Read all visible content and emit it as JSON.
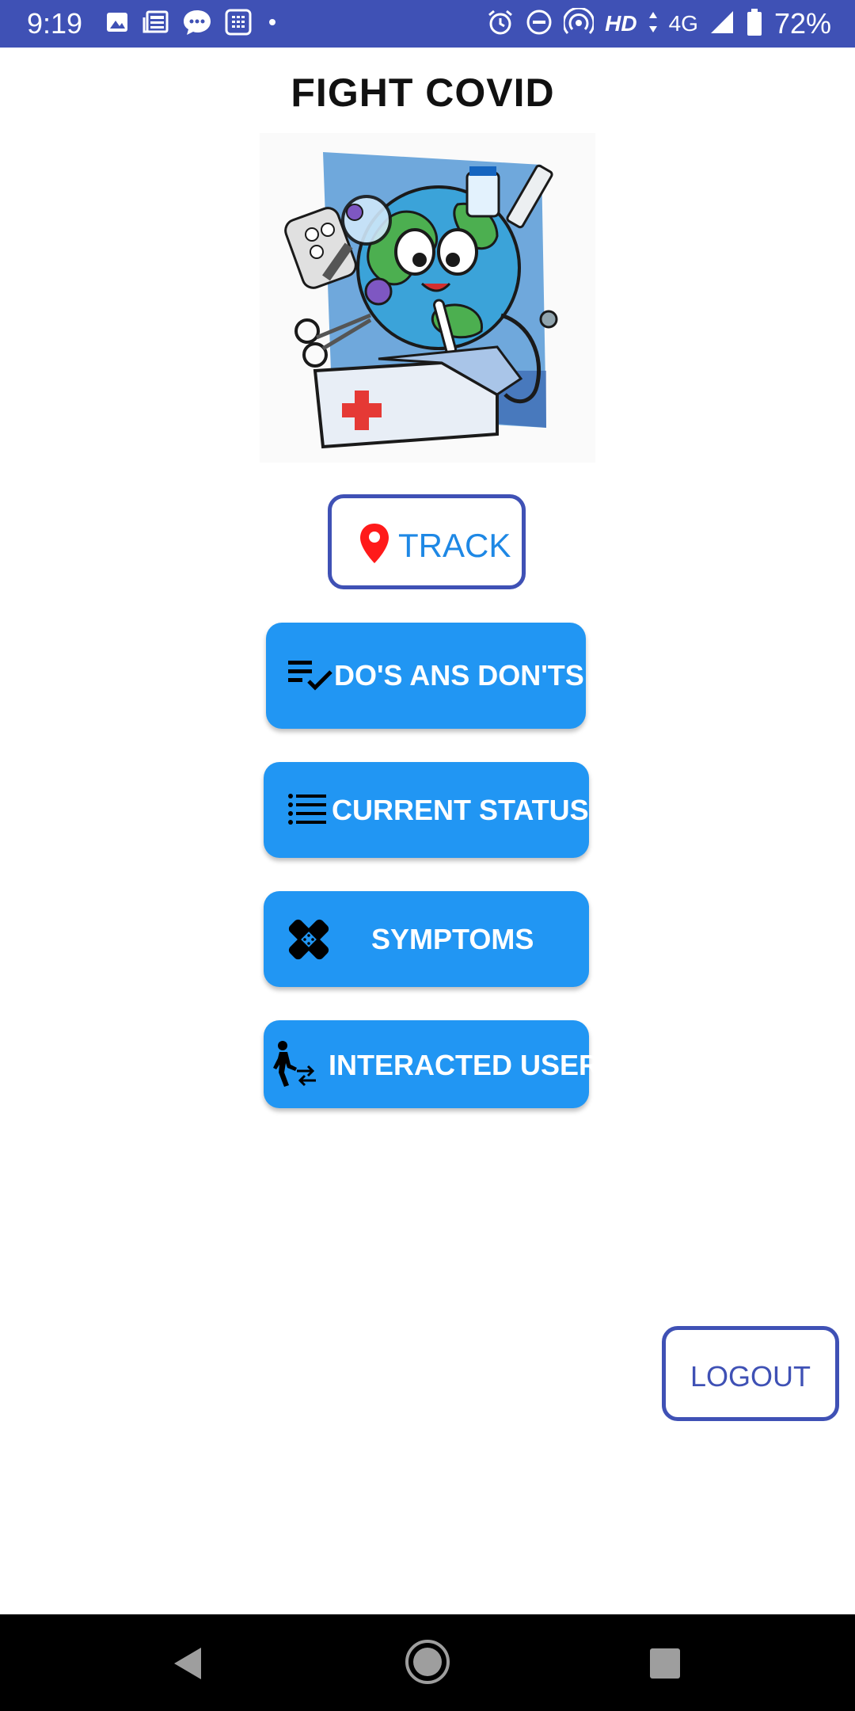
{
  "status_bar": {
    "time": "9:19",
    "network": "HD",
    "network_type": "4G",
    "battery": "72%",
    "color": "#3f51b5",
    "icons_left": [
      "image-icon",
      "news-icon",
      "chat-bubble-icon",
      "calculator-app-icon",
      "dot-icon"
    ],
    "icons_right": [
      "alarm-icon",
      "do-not-disturb-icon",
      "hotspot-icon",
      "signal-icon",
      "battery-icon"
    ]
  },
  "header": {
    "title": "FIGHT COVID"
  },
  "hero": {
    "icon": "sick-globe-illustration"
  },
  "buttons": {
    "track": {
      "label": "TRACK",
      "icon": "location-pin-icon",
      "icon_color": "#ff1a1a"
    },
    "dos": {
      "label": "DO'S ANS DON'TS",
      "icon": "checklist-icon"
    },
    "status": {
      "label": "CURRENT STATUS",
      "icon": "list-icon"
    },
    "symptoms": {
      "label": "SYMPTOMS",
      "icon": "bandage-icon"
    },
    "interacted": {
      "label": "INTERACTED USER",
      "icon": "person-exchange-icon"
    },
    "logout": {
      "label": "LOGOUT"
    }
  },
  "colors": {
    "primary": "#3f51b5",
    "button_blue": "#2196f3",
    "track_text": "#1e88e5"
  },
  "nav": {
    "icons": [
      "back-icon",
      "home-icon",
      "recents-icon"
    ]
  }
}
